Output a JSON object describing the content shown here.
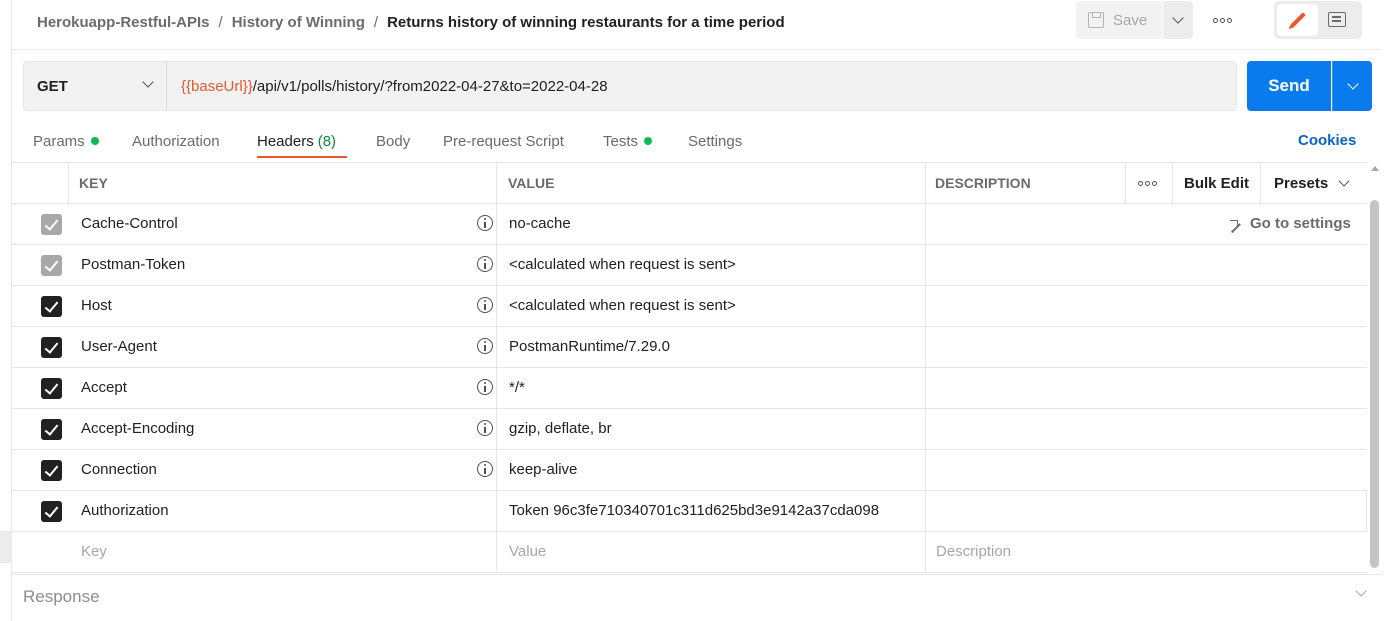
{
  "breadcrumb": {
    "collection": "Herokuapp-Restful-APIs",
    "folder": "History of Winning",
    "request": "Returns history of winning restaurants for a time period",
    "separator": "/"
  },
  "toolbar": {
    "save_label": "Save",
    "save_icon": "floppy-disk-icon",
    "more_icon": "more-horizontal-icon",
    "edit_icon": "pencil-icon",
    "comment_icon": "comment-icon"
  },
  "request": {
    "method": "GET",
    "url_variable": "{{baseUrl}}",
    "url_rest": "/api/v1/polls/history/?from2022-04-27&to=2022-04-28",
    "send_label": "Send"
  },
  "tabs": [
    {
      "label": "Params",
      "dot": true
    },
    {
      "label": "Authorization",
      "dot": false
    },
    {
      "label": "Headers",
      "count": "(8)",
      "active": true
    },
    {
      "label": "Body",
      "dot": false
    },
    {
      "label": "Pre-request Script",
      "dot": false
    },
    {
      "label": "Tests",
      "dot": true
    },
    {
      "label": "Settings",
      "dot": false
    }
  ],
  "cookies_label": "Cookies",
  "headers_table": {
    "columns": {
      "key": "KEY",
      "value": "VALUE",
      "description": "DESCRIPTION"
    },
    "bulk_edit": "Bulk Edit",
    "presets": "Presets",
    "go_to_settings": "Go to settings",
    "rows": [
      {
        "key": "Cache-Control",
        "value": "no-cache",
        "checked": true,
        "auto": true,
        "info": true
      },
      {
        "key": "Postman-Token",
        "value": "<calculated when request is sent>",
        "checked": true,
        "auto": true,
        "info": true
      },
      {
        "key": "Host",
        "value": "<calculated when request is sent>",
        "checked": true,
        "auto": false,
        "info": true
      },
      {
        "key": "User-Agent",
        "value": "PostmanRuntime/7.29.0",
        "checked": true,
        "auto": false,
        "info": true
      },
      {
        "key": "Accept",
        "value": "*/*",
        "checked": true,
        "auto": false,
        "info": true
      },
      {
        "key": "Accept-Encoding",
        "value": "gzip, deflate, br",
        "checked": true,
        "auto": false,
        "info": true
      },
      {
        "key": "Connection",
        "value": "keep-alive",
        "checked": true,
        "auto": false,
        "info": true
      },
      {
        "key": "Authorization",
        "value": "Token 96c3fe710340701c311d625bd3e9142a37cda098",
        "checked": true,
        "auto": false,
        "info": false
      }
    ],
    "new_row": {
      "key_placeholder": "Key",
      "value_placeholder": "Value",
      "description_placeholder": "Description"
    }
  },
  "response": {
    "label": "Response"
  },
  "colors": {
    "accent": "#e8582a",
    "primary": "#097bed",
    "success": "#0cbb52",
    "link": "#0b64c8"
  }
}
